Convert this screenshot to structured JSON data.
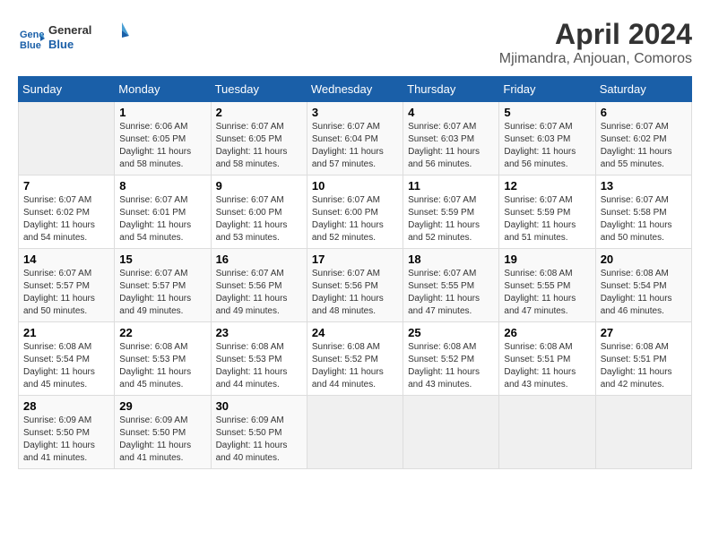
{
  "header": {
    "logo_line1": "General",
    "logo_line2": "Blue",
    "title": "April 2024",
    "location": "Mjimandra, Anjouan, Comoros"
  },
  "days_of_week": [
    "Sunday",
    "Monday",
    "Tuesday",
    "Wednesday",
    "Thursday",
    "Friday",
    "Saturday"
  ],
  "weeks": [
    [
      {
        "day": "",
        "sunrise": "",
        "sunset": "",
        "daylight": ""
      },
      {
        "day": "1",
        "sunrise": "6:06 AM",
        "sunset": "6:05 PM",
        "daylight": "11 hours and 58 minutes."
      },
      {
        "day": "2",
        "sunrise": "6:07 AM",
        "sunset": "6:05 PM",
        "daylight": "11 hours and 58 minutes."
      },
      {
        "day": "3",
        "sunrise": "6:07 AM",
        "sunset": "6:04 PM",
        "daylight": "11 hours and 57 minutes."
      },
      {
        "day": "4",
        "sunrise": "6:07 AM",
        "sunset": "6:03 PM",
        "daylight": "11 hours and 56 minutes."
      },
      {
        "day": "5",
        "sunrise": "6:07 AM",
        "sunset": "6:03 PM",
        "daylight": "11 hours and 56 minutes."
      },
      {
        "day": "6",
        "sunrise": "6:07 AM",
        "sunset": "6:02 PM",
        "daylight": "11 hours and 55 minutes."
      }
    ],
    [
      {
        "day": "7",
        "sunrise": "6:07 AM",
        "sunset": "6:02 PM",
        "daylight": "11 hours and 54 minutes."
      },
      {
        "day": "8",
        "sunrise": "6:07 AM",
        "sunset": "6:01 PM",
        "daylight": "11 hours and 54 minutes."
      },
      {
        "day": "9",
        "sunrise": "6:07 AM",
        "sunset": "6:00 PM",
        "daylight": "11 hours and 53 minutes."
      },
      {
        "day": "10",
        "sunrise": "6:07 AM",
        "sunset": "6:00 PM",
        "daylight": "11 hours and 52 minutes."
      },
      {
        "day": "11",
        "sunrise": "6:07 AM",
        "sunset": "5:59 PM",
        "daylight": "11 hours and 52 minutes."
      },
      {
        "day": "12",
        "sunrise": "6:07 AM",
        "sunset": "5:59 PM",
        "daylight": "11 hours and 51 minutes."
      },
      {
        "day": "13",
        "sunrise": "6:07 AM",
        "sunset": "5:58 PM",
        "daylight": "11 hours and 50 minutes."
      }
    ],
    [
      {
        "day": "14",
        "sunrise": "6:07 AM",
        "sunset": "5:57 PM",
        "daylight": "11 hours and 50 minutes."
      },
      {
        "day": "15",
        "sunrise": "6:07 AM",
        "sunset": "5:57 PM",
        "daylight": "11 hours and 49 minutes."
      },
      {
        "day": "16",
        "sunrise": "6:07 AM",
        "sunset": "5:56 PM",
        "daylight": "11 hours and 49 minutes."
      },
      {
        "day": "17",
        "sunrise": "6:07 AM",
        "sunset": "5:56 PM",
        "daylight": "11 hours and 48 minutes."
      },
      {
        "day": "18",
        "sunrise": "6:07 AM",
        "sunset": "5:55 PM",
        "daylight": "11 hours and 47 minutes."
      },
      {
        "day": "19",
        "sunrise": "6:08 AM",
        "sunset": "5:55 PM",
        "daylight": "11 hours and 47 minutes."
      },
      {
        "day": "20",
        "sunrise": "6:08 AM",
        "sunset": "5:54 PM",
        "daylight": "11 hours and 46 minutes."
      }
    ],
    [
      {
        "day": "21",
        "sunrise": "6:08 AM",
        "sunset": "5:54 PM",
        "daylight": "11 hours and 45 minutes."
      },
      {
        "day": "22",
        "sunrise": "6:08 AM",
        "sunset": "5:53 PM",
        "daylight": "11 hours and 45 minutes."
      },
      {
        "day": "23",
        "sunrise": "6:08 AM",
        "sunset": "5:53 PM",
        "daylight": "11 hours and 44 minutes."
      },
      {
        "day": "24",
        "sunrise": "6:08 AM",
        "sunset": "5:52 PM",
        "daylight": "11 hours and 44 minutes."
      },
      {
        "day": "25",
        "sunrise": "6:08 AM",
        "sunset": "5:52 PM",
        "daylight": "11 hours and 43 minutes."
      },
      {
        "day": "26",
        "sunrise": "6:08 AM",
        "sunset": "5:51 PM",
        "daylight": "11 hours and 43 minutes."
      },
      {
        "day": "27",
        "sunrise": "6:08 AM",
        "sunset": "5:51 PM",
        "daylight": "11 hours and 42 minutes."
      }
    ],
    [
      {
        "day": "28",
        "sunrise": "6:09 AM",
        "sunset": "5:50 PM",
        "daylight": "11 hours and 41 minutes."
      },
      {
        "day": "29",
        "sunrise": "6:09 AM",
        "sunset": "5:50 PM",
        "daylight": "11 hours and 41 minutes."
      },
      {
        "day": "30",
        "sunrise": "6:09 AM",
        "sunset": "5:50 PM",
        "daylight": "11 hours and 40 minutes."
      },
      {
        "day": "",
        "sunrise": "",
        "sunset": "",
        "daylight": ""
      },
      {
        "day": "",
        "sunrise": "",
        "sunset": "",
        "daylight": ""
      },
      {
        "day": "",
        "sunrise": "",
        "sunset": "",
        "daylight": ""
      },
      {
        "day": "",
        "sunrise": "",
        "sunset": "",
        "daylight": ""
      }
    ]
  ],
  "labels": {
    "sunrise_prefix": "Sunrise: ",
    "sunset_prefix": "Sunset: ",
    "daylight_prefix": "Daylight: "
  }
}
